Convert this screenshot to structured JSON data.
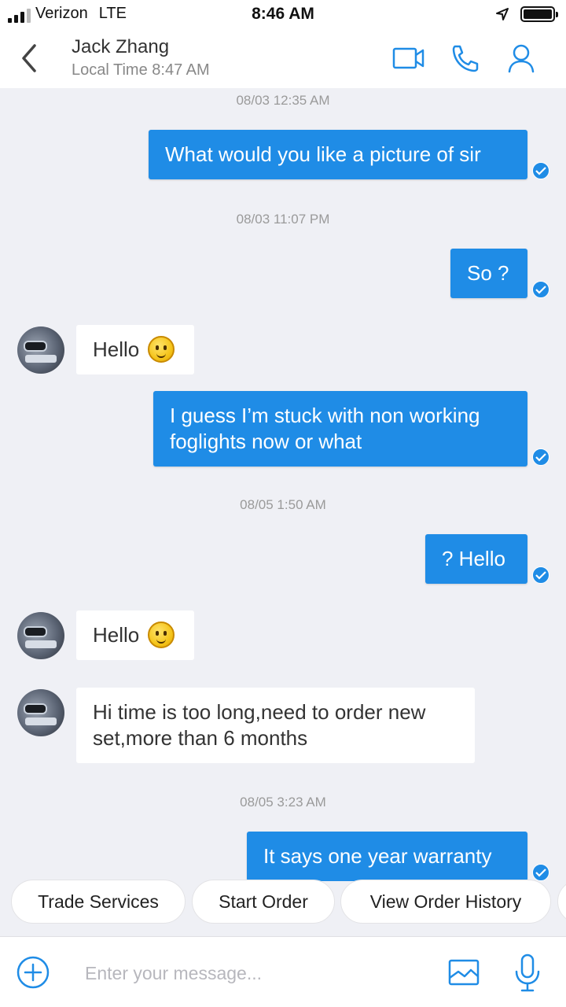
{
  "status": {
    "carrier": "Verizon",
    "network": "LTE",
    "time": "8:46 AM"
  },
  "header": {
    "name": "Jack Zhang",
    "subtitle": "Local Time 8:47 AM",
    "icons": [
      "back-icon",
      "video-call-icon",
      "phone-icon",
      "profile-icon"
    ]
  },
  "messages": [
    {
      "type": "timestamp",
      "text": "08/03 12:35 AM"
    },
    {
      "type": "outgoing",
      "text": "What would you like a picture of sir"
    },
    {
      "type": "timestamp",
      "text": "08/03 11:07 PM"
    },
    {
      "type": "outgoing",
      "text": "So ?"
    },
    {
      "type": "incoming",
      "text": "Hello"
    },
    {
      "type": "outgoing",
      "text": "I guess I’m stuck with non working foglights now or what"
    },
    {
      "type": "timestamp",
      "text": "08/05 1:50 AM"
    },
    {
      "type": "outgoing",
      "text": "? Hello"
    },
    {
      "type": "incoming",
      "text": "Hello"
    },
    {
      "type": "incoming",
      "text": "Hi time is too long,need to order new set,more than 6 months"
    },
    {
      "type": "timestamp",
      "text": "08/05 3:23 AM"
    },
    {
      "type": "outgoing",
      "text": "It says one year warranty"
    }
  ],
  "quick_replies": [
    "Trade Services",
    "Start Order",
    "View Order History"
  ],
  "composer": {
    "placeholder": "Enter your message...",
    "icons": [
      "add-icon",
      "image-icon",
      "microphone-icon"
    ]
  },
  "colors": {
    "accent": "#1f8ce6",
    "background": "#eff0f5"
  }
}
